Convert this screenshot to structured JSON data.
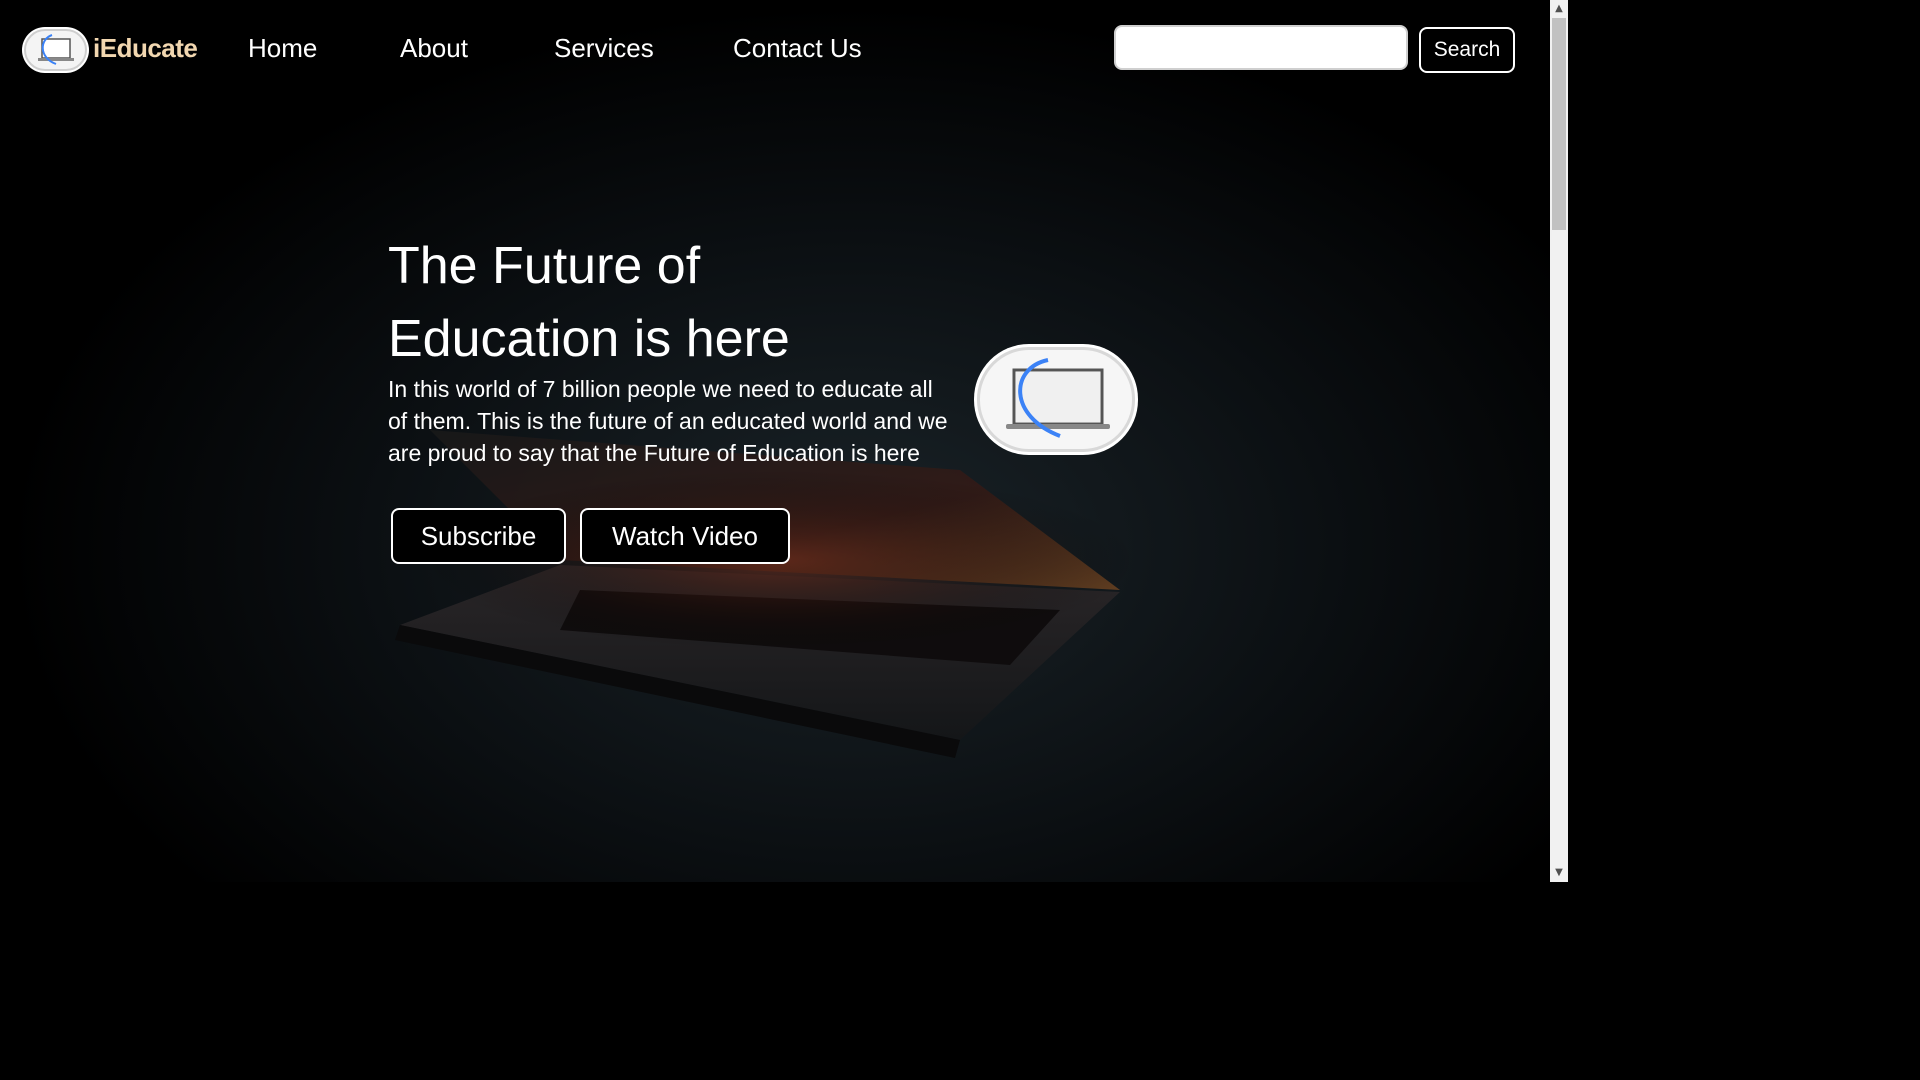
{
  "nav": {
    "brand": "iEducate",
    "links": [
      "Home",
      "About",
      "Services",
      "Contact Us"
    ],
    "search_placeholder": "",
    "search_label": "Search"
  },
  "hero": {
    "title_line1": "The Future of",
    "title_line2": "Education is here",
    "text": "In this world of 7 billion people we need to educate all of them. This is the future of an educated world and we are proud to say that the Future of Education is here",
    "subscribe_label": "Subscribe",
    "video_label": "Watch Video"
  },
  "icons": {
    "logo": "laptop-logo-icon",
    "scroll_up": "scroll-up-icon",
    "scroll_down": "scroll-down-icon"
  },
  "colors": {
    "brand": "#f2d7b0",
    "background": "#000000",
    "logo_accent": "#3b82f6"
  }
}
